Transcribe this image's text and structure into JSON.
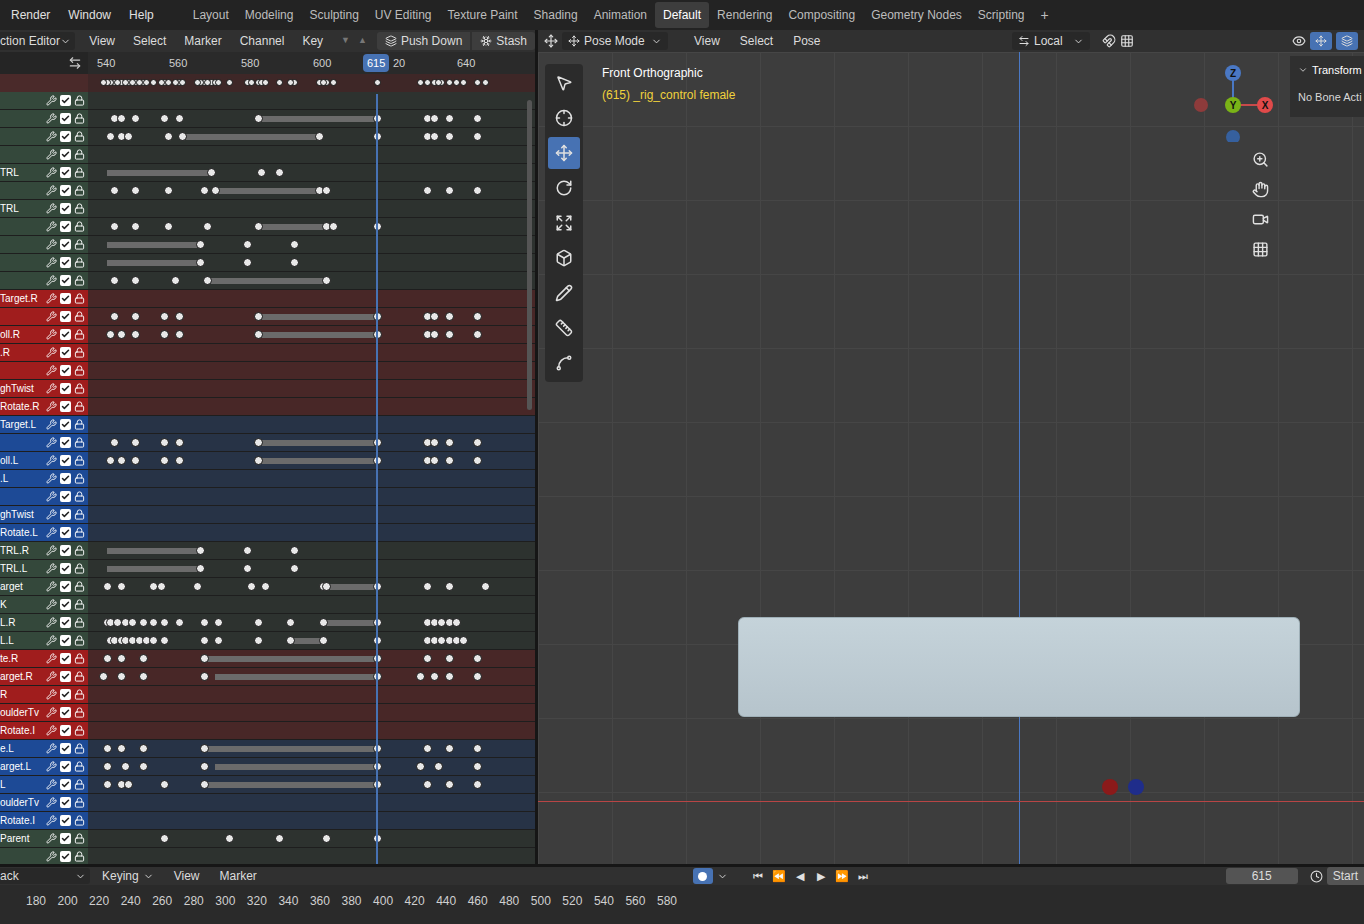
{
  "menu": [
    "Render",
    "Window",
    "Help"
  ],
  "workspaces": [
    {
      "label": "Layout",
      "selected": false
    },
    {
      "label": "Modeling",
      "selected": false
    },
    {
      "label": "Sculpting",
      "selected": false
    },
    {
      "label": "UV Editing",
      "selected": false
    },
    {
      "label": "Texture Paint",
      "selected": false
    },
    {
      "label": "Shading",
      "selected": false
    },
    {
      "label": "Animation",
      "selected": false
    },
    {
      "label": "Default",
      "selected": true
    },
    {
      "label": "Rendering",
      "selected": false
    },
    {
      "label": "Compositing",
      "selected": false
    },
    {
      "label": "Geometry Nodes",
      "selected": false
    },
    {
      "label": "Scripting",
      "selected": false
    }
  ],
  "add_workspace": "+",
  "action_editor": {
    "mode": "ction Editor",
    "menu": [
      "View",
      "Select",
      "Marker",
      "Channel",
      "Key"
    ],
    "arrows": [
      "▼",
      "▲"
    ],
    "push_down": "Push Down",
    "stash": "Stash",
    "ruler": [
      "540",
      "560",
      "580",
      "600",
      "20",
      "640"
    ],
    "current_frame": "615",
    "channels": [
      {
        "name": "",
        "color": "#34483b",
        "keys": [],
        "holds": []
      },
      {
        "name": "",
        "color": "#34483b",
        "keys": [
          542,
          544,
          548,
          556,
          560,
          582,
          615,
          629,
          631,
          635,
          643
        ],
        "holds": [
          [
            582,
            615
          ]
        ]
      },
      {
        "name": "",
        "color": "#34483b",
        "keys": [
          541,
          544,
          546,
          557,
          561,
          599,
          615,
          629,
          631,
          635,
          643
        ],
        "holds": [
          [
            561,
            599
          ]
        ]
      },
      {
        "name": "",
        "color": "#34483b",
        "keys": [],
        "holds": []
      },
      {
        "name": "TRL",
        "color": "#34483b",
        "keys": [
          569,
          583,
          588
        ],
        "holds": [
          [
            540,
            569
          ]
        ]
      },
      {
        "name": "",
        "color": "#34483b",
        "keys": [
          542,
          548,
          557,
          567,
          570,
          599,
          601,
          629,
          635,
          643
        ],
        "holds": [
          [
            570,
            599
          ]
        ]
      },
      {
        "name": "TRL",
        "color": "#34483b",
        "keys": [],
        "holds": []
      },
      {
        "name": "",
        "color": "#34483b",
        "keys": [
          542,
          548,
          557,
          568,
          582,
          601,
          603,
          615
        ],
        "holds": [
          [
            582,
            601
          ]
        ]
      },
      {
        "name": "",
        "color": "#34483b",
        "keys": [
          566,
          579,
          592
        ],
        "holds": [
          [
            540,
            566
          ]
        ]
      },
      {
        "name": "",
        "color": "#34483b",
        "keys": [
          566,
          579,
          592
        ],
        "holds": [
          [
            540,
            566
          ]
        ]
      },
      {
        "name": "",
        "color": "#34483b",
        "keys": [
          542,
          548,
          559,
          568,
          601
        ],
        "holds": [
          [
            568,
            601
          ]
        ]
      },
      {
        "name": "Target.R",
        "color": "#a01d1d",
        "keys": [],
        "holds": []
      },
      {
        "name": "",
        "color": "#a01d1d",
        "keys": [
          542,
          548,
          556,
          560,
          582,
          615,
          629,
          631,
          635,
          643
        ],
        "holds": [
          [
            582,
            615
          ]
        ]
      },
      {
        "name": "oll.R",
        "color": "#a01d1d",
        "keys": [
          541,
          544,
          548,
          556,
          560,
          582,
          615,
          629,
          631,
          635,
          643
        ],
        "holds": [
          [
            582,
            615
          ]
        ]
      },
      {
        "name": ".R",
        "color": "#a01d1d",
        "keys": [],
        "holds": []
      },
      {
        "name": "",
        "color": "#a01d1d",
        "keys": [],
        "holds": []
      },
      {
        "name": "ghTwist",
        "color": "#a01d1d",
        "keys": [],
        "holds": []
      },
      {
        "name": "Rotate.R",
        "color": "#a01d1d",
        "keys": [],
        "holds": []
      },
      {
        "name": "Target.L",
        "color": "#1d4a96",
        "keys": [],
        "holds": []
      },
      {
        "name": "",
        "color": "#1d4a96",
        "keys": [
          542,
          548,
          556,
          560,
          582,
          615,
          629,
          631,
          635,
          643
        ],
        "holds": [
          [
            582,
            615
          ]
        ]
      },
      {
        "name": "oll.L",
        "color": "#1d4a96",
        "keys": [
          541,
          544,
          548,
          556,
          560,
          582,
          615,
          629,
          631,
          635,
          643
        ],
        "holds": [
          [
            582,
            615
          ]
        ]
      },
      {
        "name": ".L",
        "color": "#1d4a96",
        "keys": [],
        "holds": []
      },
      {
        "name": "",
        "color": "#1d4a96",
        "keys": [],
        "holds": []
      },
      {
        "name": "ghTwist",
        "color": "#1d4a96",
        "keys": [],
        "holds": []
      },
      {
        "name": "Rotate.L",
        "color": "#1d4a96",
        "keys": [],
        "holds": []
      },
      {
        "name": "TRL.R",
        "color": "#34483b",
        "keys": [
          566,
          579,
          592
        ],
        "holds": [
          [
            540,
            566
          ]
        ]
      },
      {
        "name": "TRL.L",
        "color": "#34483b",
        "keys": [
          566,
          579,
          592
        ],
        "holds": [
          [
            540,
            566
          ]
        ]
      },
      {
        "name": "arget",
        "color": "#34483b",
        "keys": [
          540,
          544,
          553,
          555,
          565,
          580,
          584,
          600,
          601,
          615,
          629,
          635,
          645
        ],
        "holds": [
          [
            601,
            615
          ]
        ]
      },
      {
        "name": "K",
        "color": "#34483b",
        "keys": [],
        "holds": []
      },
      {
        "name": "L.R",
        "color": "#34483b",
        "keys": [
          540,
          541,
          543,
          545,
          547,
          550,
          553,
          556,
          560,
          567,
          571,
          582,
          591,
          600,
          615,
          629,
          631,
          633,
          635,
          637
        ],
        "holds": [
          [
            600,
            615
          ]
        ]
      },
      {
        "name": "L.L",
        "color": "#34483b",
        "keys": [
          541,
          542,
          544,
          545,
          547,
          549,
          551,
          553,
          556,
          567,
          571,
          582,
          591,
          600,
          615,
          629,
          631,
          633,
          635,
          637,
          639
        ],
        "holds": [
          [
            591,
            600
          ]
        ]
      },
      {
        "name": "te.R",
        "color": "#a01d1d",
        "keys": [
          540,
          544,
          550,
          567,
          615,
          629,
          635,
          643
        ],
        "holds": [
          [
            567,
            615
          ]
        ]
      },
      {
        "name": "arget.R",
        "color": "#a01d1d",
        "keys": [
          539,
          544,
          550,
          567,
          615,
          627,
          631,
          635,
          643
        ],
        "holds": [
          [
            570,
            615
          ]
        ]
      },
      {
        "name": "R",
        "color": "#a01d1d",
        "keys": [],
        "holds": []
      },
      {
        "name": "oulderTv",
        "color": "#a01d1d",
        "keys": [],
        "holds": []
      },
      {
        "name": "Rotate.I",
        "color": "#a01d1d",
        "keys": [],
        "holds": []
      },
      {
        "name": "e.L",
        "color": "#1d4a96",
        "keys": [
          540,
          544,
          550,
          567,
          615,
          629,
          635,
          643
        ],
        "holds": [
          [
            567,
            615
          ]
        ]
      },
      {
        "name": "arget.L",
        "color": "#1d4a96",
        "keys": [
          540,
          545,
          550,
          567,
          615,
          627,
          632,
          643
        ],
        "holds": [
          [
            570,
            615
          ]
        ]
      },
      {
        "name": "L",
        "color": "#1d4a96",
        "keys": [
          540,
          544,
          546,
          556,
          567,
          615,
          629,
          635,
          643
        ],
        "holds": [
          [
            567,
            615
          ]
        ]
      },
      {
        "name": "oulderTv",
        "color": "#1d4a96",
        "keys": [],
        "holds": []
      },
      {
        "name": "Rotate.I",
        "color": "#1d4a96",
        "keys": [],
        "holds": []
      },
      {
        "name": "Parent",
        "color": "#34483b",
        "keys": [
          556,
          574,
          588,
          601,
          615
        ],
        "holds": []
      },
      {
        "name": "",
        "color": "#34483b",
        "keys": [],
        "holds": []
      }
    ]
  },
  "viewport": {
    "mode": "Pose Mode",
    "menu": [
      "View",
      "Select",
      "Pose"
    ],
    "orientation": "Local",
    "view_name": "Front Orthographic",
    "object_label": "(615) _rig_control female",
    "axes": [
      "Z",
      "Y",
      "X"
    ],
    "panel": {
      "title": "Transform",
      "message": "No Bone Acti"
    }
  },
  "timeline": {
    "mode": "ack",
    "keying": "Keying",
    "menu": [
      "View",
      "Marker"
    ],
    "playback": [
      "⏮",
      "⏪",
      "◀",
      "▶",
      "⏩",
      "⏭"
    ],
    "frame": "615",
    "start": "Start",
    "ruler": [
      "180",
      "200",
      "220",
      "240",
      "260",
      "280",
      "300",
      "320",
      "340",
      "360",
      "380",
      "400",
      "420",
      "440",
      "460",
      "480",
      "500",
      "520",
      "540",
      "560",
      "580"
    ]
  }
}
